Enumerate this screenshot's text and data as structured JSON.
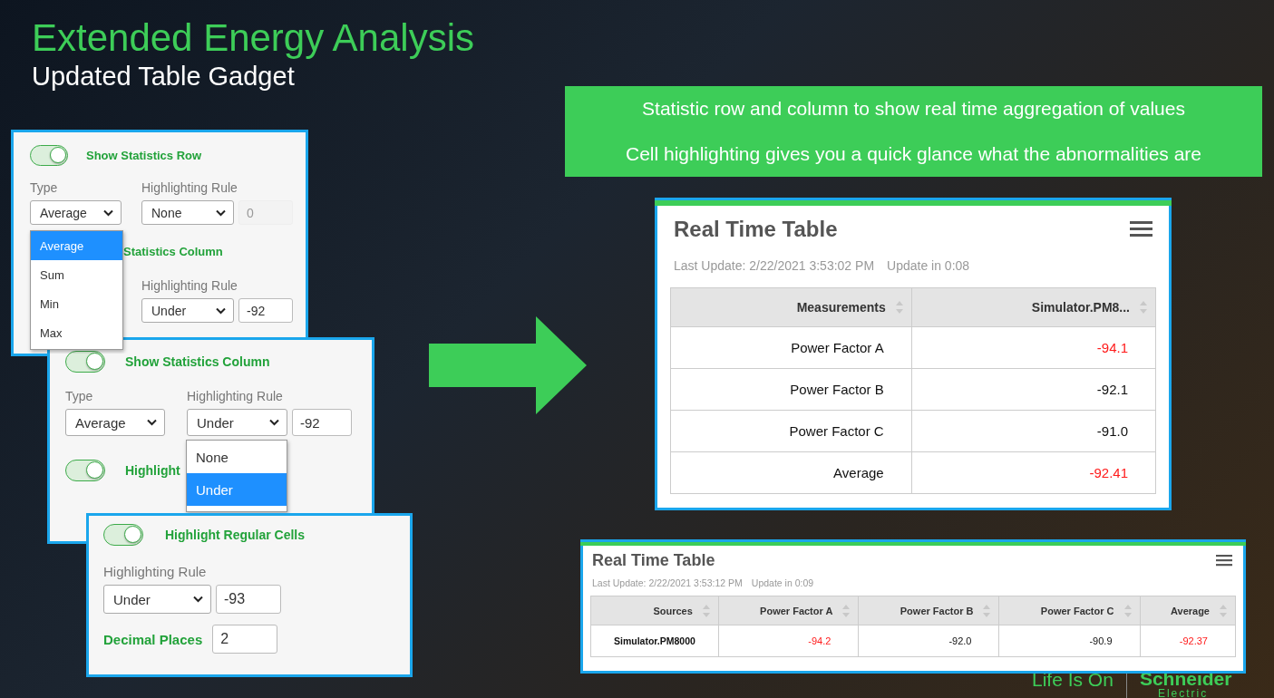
{
  "title": "Extended Energy Analysis",
  "subtitle": "Updated Table Gadget",
  "callout": {
    "lines": [
      "Statistic row and column to show real time aggregation of values",
      "Cell highlighting gives you a quick glance what the abnormalities are"
    ]
  },
  "row_panel": {
    "toggle": {
      "label": "Show Statistics Row",
      "on": true
    },
    "type_label": "Type",
    "type_value": "Average",
    "rule_label": "Highlighting Rule",
    "rule_value": "None",
    "threshold": "0",
    "threshold_disabled": true,
    "type_options": [
      {
        "label": "Average",
        "selected": true
      },
      {
        "label": "Sum",
        "selected": false
      },
      {
        "label": "Min",
        "selected": false
      },
      {
        "label": "Max",
        "selected": false
      }
    ],
    "column_label": "Statistics Column",
    "column_rule_label": "Highlighting Rule",
    "column_rule_value": "Under",
    "column_threshold": "-92"
  },
  "column_panel": {
    "toggle": {
      "label": "Show Statistics Column",
      "on": true
    },
    "type_label": "Type",
    "type_value": "Average",
    "rule_label": "Highlighting Rule",
    "rule_value": "Under",
    "threshold": "-92",
    "rule_options": [
      {
        "label": "None",
        "selected": false
      },
      {
        "label": "Under",
        "selected": true
      }
    ],
    "next_toggle": {
      "label": "Highlight",
      "on": true
    }
  },
  "cells_panel": {
    "toggle": {
      "label": "Highlight Regular Cells",
      "on": true
    },
    "rule_label": "Highlighting Rule",
    "rule_value": "Under",
    "threshold": "-93",
    "decimal_label": "Decimal Places",
    "decimal_value": "2"
  },
  "tables": [
    {
      "title": "Real Time Table",
      "last_update": "Last Update: 2/22/2021 3:53:02 PM",
      "update_in": "Update in 0:08",
      "columns": [
        "Measurements",
        "Simulator.PM8..."
      ],
      "rows": [
        [
          {
            "text": "Power Factor A",
            "alert": false
          },
          {
            "text": "-94.1",
            "alert": true
          }
        ],
        [
          {
            "text": "Power Factor B",
            "alert": false
          },
          {
            "text": "-92.1",
            "alert": false
          }
        ],
        [
          {
            "text": "Power Factor C",
            "alert": false
          },
          {
            "text": "-91.0",
            "alert": false
          }
        ],
        [
          {
            "text": "Average",
            "alert": false
          },
          {
            "text": "-92.41",
            "alert": true
          }
        ]
      ]
    },
    {
      "title": "Real Time Table",
      "last_update": "Last Update: 2/22/2021 3:53:12 PM",
      "update_in": "Update in 0:09",
      "columns": [
        "Sources",
        "Power Factor A",
        "Power Factor B",
        "Power Factor C",
        "Average"
      ],
      "rows": [
        [
          {
            "text": "Simulator.PM8000",
            "alert": false
          },
          {
            "text": "-94.2",
            "alert": true
          },
          {
            "text": "-92.0",
            "alert": false
          },
          {
            "text": "-90.9",
            "alert": false
          },
          {
            "text": "-92.37",
            "alert": true
          }
        ]
      ]
    }
  ],
  "logo": {
    "tagline": "Life Is On",
    "brand": "Schneider",
    "brand_sub": "Electric"
  }
}
